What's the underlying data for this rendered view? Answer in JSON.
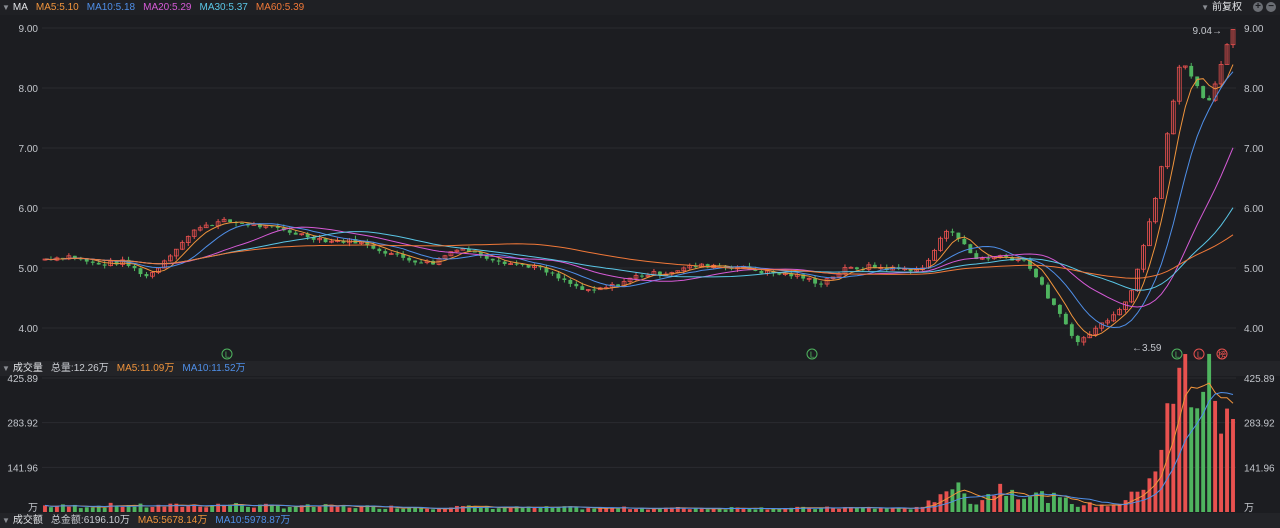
{
  "header": {
    "title": "MA",
    "ma5": "MA5:5.10",
    "ma10": "MA10:5.18",
    "ma20": "MA20:5.29",
    "ma30": "MA30:5.37",
    "ma60": "MA60:5.39",
    "adjust": "前复权",
    "plus": "+",
    "minus": "−"
  },
  "volume_header": {
    "title": "成交量",
    "total": "总量:12.26万",
    "ma5": "MA5:11.09万",
    "ma10": "MA10:11.52万"
  },
  "amount_header": {
    "title": "成交额",
    "total": "总金额:6196.10万",
    "ma5": "MA5:5678.14万",
    "ma10": "MA10:5978.87万"
  },
  "colors": {
    "up": "#e8514f",
    "down": "#4fb45f",
    "ma5": "#f0943c",
    "ma10": "#4f8fe8",
    "ma20": "#d55ad6",
    "ma30": "#5ac6e6",
    "ma60": "#f07838",
    "background": "#1c1d21",
    "grid": "#2a2b30"
  },
  "chart_data": {
    "type": "candlestick",
    "price_axis": {
      "ticks": [
        "9.00",
        "8.00",
        "7.00",
        "6.00",
        "5.00",
        "4.00"
      ],
      "ylim": [
        3.5,
        9.2
      ]
    },
    "volume_axis": {
      "ticks": [
        "425.89",
        "283.92",
        "141.96"
      ],
      "unit": "万",
      "ylim": [
        0,
        425.89
      ]
    },
    "annotations": {
      "high": "9.04→",
      "low": "←3.59"
    },
    "markers": [
      "L",
      "L",
      "L",
      "L",
      "榜"
    ],
    "price_anchors": [
      5.15,
      5.2,
      5.05,
      5.1,
      4.85,
      5.3,
      5.7,
      5.78,
      5.72,
      5.65,
      5.55,
      5.45,
      5.45,
      5.3,
      5.15,
      5.08,
      5.35,
      5.2,
      5.08,
      5.02,
      4.8,
      4.6,
      4.7,
      4.88,
      4.92,
      5.02,
      5.05,
      5.0,
      4.92,
      4.88,
      4.75,
      4.98,
      5.02,
      4.98,
      4.98,
      5.7,
      5.15,
      5.2,
      5.12,
      4.4,
      3.75,
      4.1,
      4.5,
      6.2,
      8.5,
      7.7,
      9.0
    ],
    "volume_anchors": [
      20,
      18,
      20,
      22,
      18,
      20,
      22,
      24,
      20,
      18,
      18,
      18,
      17,
      16,
      16,
      14,
      16,
      15,
      14,
      13,
      14,
      12,
      12,
      13,
      12,
      12,
      12,
      14,
      12,
      12,
      12,
      14,
      12,
      12,
      12,
      90,
      30,
      80,
      60,
      45,
      25,
      20,
      40,
      150,
      425,
      400,
      250
    ]
  }
}
